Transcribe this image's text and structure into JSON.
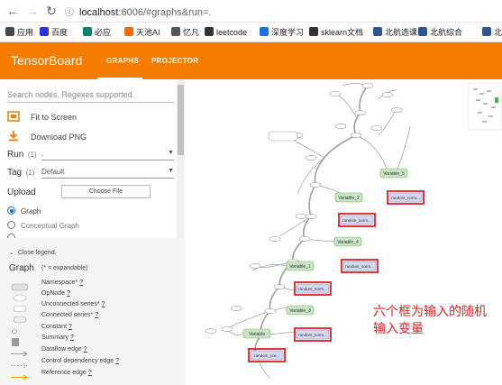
{
  "browser": {
    "url_host": "localhost",
    "url_path": ":6006/#graphs&run=."
  },
  "bookmarks": [
    {
      "label": "应用",
      "color": "#4a4a4a"
    },
    {
      "label": "百度",
      "color": "#2932e1"
    },
    {
      "label": "必应",
      "color": "#008373"
    },
    {
      "label": "天池AI",
      "color": "#ff6a00"
    },
    {
      "label": "忆凡",
      "color": "#555555"
    },
    {
      "label": "leetcode",
      "color": "#333333"
    },
    {
      "label": "深度学习",
      "color": "#1a73e8"
    },
    {
      "label": "sklearn文档",
      "color": "#333333"
    },
    {
      "label": "北航选课",
      "color": "#2b5797"
    },
    {
      "label": "北航综合",
      "color": "#2b5797"
    },
    {
      "label": "北",
      "color": "#2b5797"
    }
  ],
  "header": {
    "title": "TensorBoard",
    "tabs": [
      "GRAPHS",
      "PROJECTOR"
    ],
    "active_tab": "GRAPHS",
    "color": "#f57c00"
  },
  "sidebar": {
    "search_placeholder": "Search nodes. Regexes supported.",
    "fit_label": "Fit to Screen",
    "download_label": "Download PNG",
    "run_label": "Run",
    "run_count": "(1)",
    "run_value": ".",
    "tag_label": "Tag",
    "tag_count": "(1)",
    "tag_value": "Default",
    "upload_label": "Upload",
    "choose_file_label": "Choose File",
    "graph_radio": "Graph",
    "conceptual_radio": "Conceptual Graph",
    "selected_radio": "Graph"
  },
  "legend": {
    "close_label": "Close legend.",
    "title": "Graph",
    "subtitle": "(* = expandable)",
    "items": [
      {
        "label": "Namespace*",
        "help": "?",
        "icon": "namespace-icon"
      },
      {
        "label": "OpNode",
        "help": "?",
        "icon": "opnode-icon"
      },
      {
        "label": "Unconnected series*",
        "help": "?",
        "icon": "unconnected-series-icon"
      },
      {
        "label": "Connected series*",
        "help": "?",
        "icon": "connected-series-icon"
      },
      {
        "label": "Constant",
        "help": "?",
        "icon": "constant-icon"
      },
      {
        "label": "Summary",
        "help": "?",
        "icon": "summary-icon"
      },
      {
        "label": "Dataflow edge",
        "help": "?",
        "icon": "dataflow-edge-icon"
      },
      {
        "label": "Control dependency edge",
        "help": "?",
        "icon": "control-edge-icon"
      },
      {
        "label": "Reference edge",
        "help": "?",
        "icon": "reference-edge-icon"
      }
    ]
  },
  "graph": {
    "variable_nodes": [
      "Variable_5",
      "Variable_2",
      "Variable_4",
      "Variable_1",
      "Variable_3",
      "Variable"
    ],
    "random_nodes": [
      "random_norm...",
      "random_norm...",
      "random_norm...",
      "random_norm...",
      "random_norm...",
      "random_nor..."
    ],
    "highlight_color": "#e02020"
  },
  "annotation": {
    "text": "六个框为输入的随机输入变量"
  }
}
